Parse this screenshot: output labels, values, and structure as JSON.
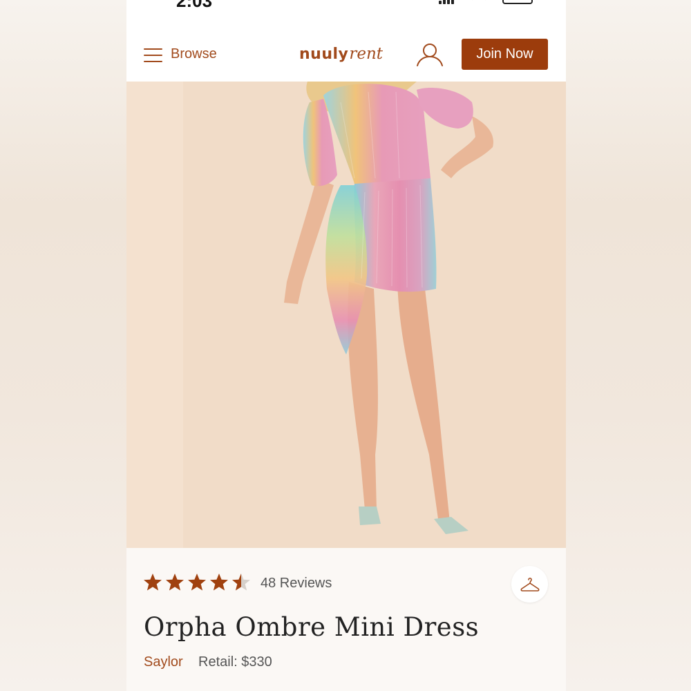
{
  "status_bar": {
    "time": "2:03"
  },
  "header": {
    "menu_label": "Browse",
    "logo_bold": "nuuly",
    "logo_italic": "rent",
    "join_label": "Join Now"
  },
  "product": {
    "rating": 4.5,
    "reviews_label": "48 Reviews",
    "title": "Orpha Ombre Mini Dress",
    "brand": "Saylor",
    "retail_label": "Retail: $330"
  },
  "colors": {
    "accent": "#a14a1c",
    "button": "#9c3c0c",
    "star": "#a0410f"
  },
  "icons": {
    "menu": "hamburger-icon",
    "account": "user-icon",
    "closet": "hanger-icon",
    "rating": "star-icon"
  }
}
